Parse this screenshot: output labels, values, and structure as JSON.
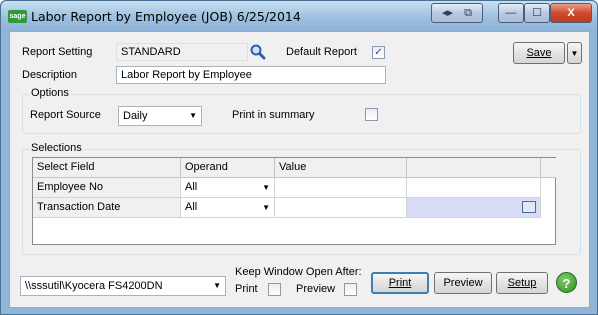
{
  "window": {
    "title": "Labor Report by Employee (JOB) 6/25/2014",
    "app_icon": "sage"
  },
  "title_buttons": [
    {
      "name": "help-nav-icon",
      "glyph": "◂▸"
    },
    {
      "name": "restore-icon",
      "glyph": "⧉"
    },
    {
      "name": "minimize-icon",
      "glyph": "—"
    },
    {
      "name": "maximize-icon",
      "glyph": "☐"
    },
    {
      "name": "close-icon",
      "glyph": "X"
    }
  ],
  "header": {
    "report_setting_label": "Report Setting",
    "report_setting_value": "STANDARD",
    "default_report_label": "Default Report",
    "default_report_checked": true,
    "description_label": "Description",
    "description_value": "Labor Report by Employee",
    "save_label": "Save"
  },
  "options": {
    "title": "Options",
    "report_source_label": "Report Source",
    "report_source_value": "Daily",
    "print_summary_label": "Print in summary",
    "print_summary_checked": false
  },
  "selections": {
    "title": "Selections",
    "columns": [
      "Select Field",
      "Operand",
      "Value",
      ""
    ],
    "rows": [
      {
        "field": "Employee No",
        "operand": "All",
        "value": ""
      },
      {
        "field": "Transaction Date",
        "operand": "All",
        "value": ""
      }
    ]
  },
  "footer": {
    "printer": "\\\\sssutil\\Kyocera FS4200DN",
    "keep_open_label": "Keep Window Open After:",
    "print_check_label": "Print",
    "preview_check_label": "Preview",
    "print_button": "Print",
    "preview_button": "Preview",
    "setup_button": "Setup",
    "help_glyph": "?"
  },
  "colors": {
    "titlebar": "#9dc0e0",
    "client_bg": "#f0f0f0",
    "highlight_cell": "#d8dcf5",
    "accent_border": "#3c7fb1"
  }
}
